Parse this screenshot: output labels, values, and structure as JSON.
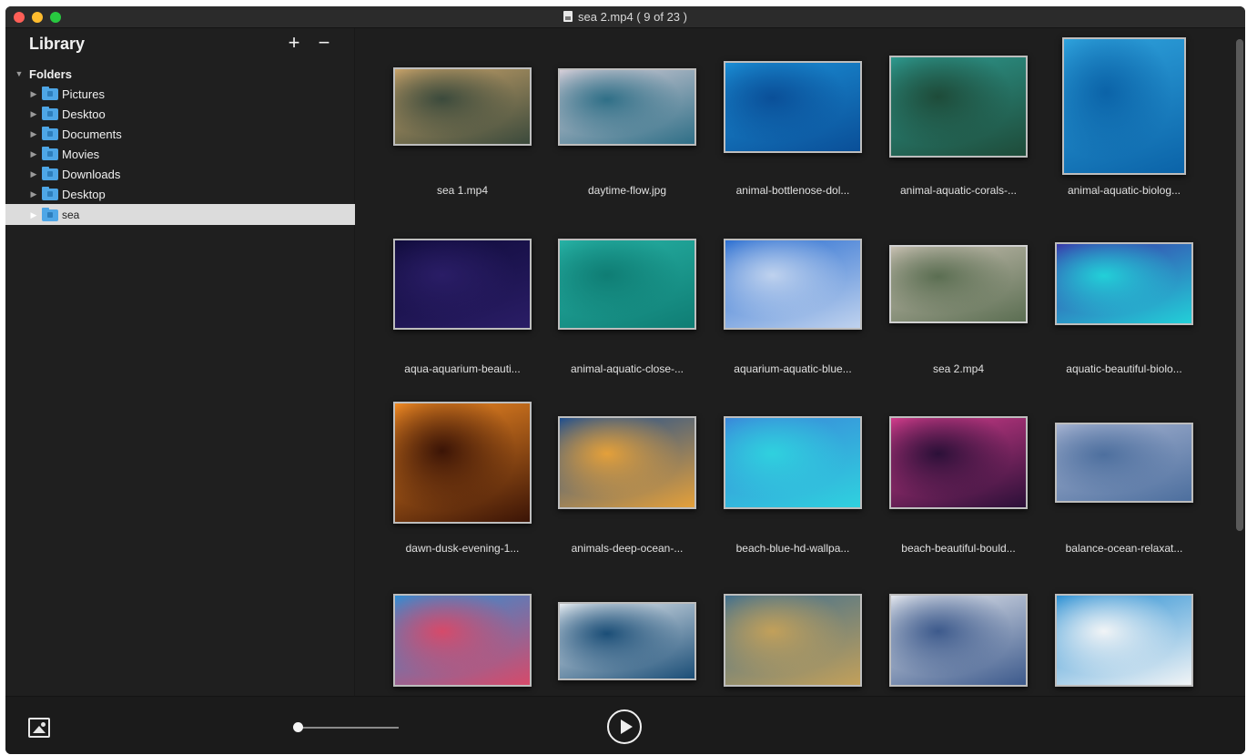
{
  "window": {
    "title": "sea 2.mp4 ( 9 of 23 )"
  },
  "sidebar": {
    "title": "Library",
    "add_label": "+",
    "remove_label": "−",
    "root": "Folders",
    "folders": [
      {
        "label": "Pictures"
      },
      {
        "label": "Desktoo"
      },
      {
        "label": "Documents"
      },
      {
        "label": "Movies"
      },
      {
        "label": "Downloads"
      },
      {
        "label": "Desktop"
      },
      {
        "label": "sea",
        "selected": true
      }
    ]
  },
  "gallery": {
    "items": [
      {
        "label": "sea 1.mp4",
        "colors": [
          "#c9a36a",
          "#3b4a3c"
        ]
      },
      {
        "label": "daytime-flow.jpg",
        "colors": [
          "#d7cfd9",
          "#2f6f87"
        ]
      },
      {
        "label": "animal-bottlenose-dol...",
        "colors": [
          "#1b8fd6",
          "#0a4f98"
        ]
      },
      {
        "label": "animal-aquatic-corals-...",
        "colors": [
          "#2e9a90",
          "#1e4b39"
        ]
      },
      {
        "label": "animal-aquatic-biolog...",
        "colors": [
          "#2fa3dd",
          "#0b63a8"
        ]
      },
      {
        "label": "aqua-aquarium-beauti...",
        "colors": [
          "#0f0b3a",
          "#2a1d66"
        ]
      },
      {
        "label": "animal-aquatic-close-...",
        "colors": [
          "#27b3a6",
          "#0f7d74"
        ]
      },
      {
        "label": "aquarium-aquatic-blue...",
        "colors": [
          "#2a6ed1",
          "#bfd2ee"
        ]
      },
      {
        "label": "sea 2.mp4",
        "colors": [
          "#c9c1b3",
          "#5b6e52"
        ]
      },
      {
        "label": "aquatic-beautiful-biolo...",
        "colors": [
          "#3a36a9",
          "#22d0d8"
        ]
      },
      {
        "label": "dawn-dusk-evening-1...",
        "colors": [
          "#f28b24",
          "#3b1406"
        ]
      },
      {
        "label": "animals-deep-ocean-...",
        "colors": [
          "#1d4e8f",
          "#e4a03a"
        ]
      },
      {
        "label": "beach-blue-hd-wallpa...",
        "colors": [
          "#3a86da",
          "#2fd1de"
        ]
      },
      {
        "label": "beach-beautiful-bould...",
        "colors": [
          "#d43d8c",
          "#2b1038"
        ]
      },
      {
        "label": "balance-ocean-relaxat...",
        "colors": [
          "#a7b4d2",
          "#4d6f9e"
        ]
      },
      {
        "label": "",
        "colors": [
          "#2e8fd6",
          "#d64a6a"
        ]
      },
      {
        "label": "",
        "colors": [
          "#e9eef3",
          "#1b4e77"
        ]
      },
      {
        "label": "",
        "colors": [
          "#3f6f8f",
          "#c2a05a"
        ]
      },
      {
        "label": "",
        "colors": [
          "#e6e9ef",
          "#3d5a8c"
        ]
      },
      {
        "label": "",
        "colors": [
          "#2a8fd3",
          "#f1f4f6"
        ]
      }
    ]
  }
}
